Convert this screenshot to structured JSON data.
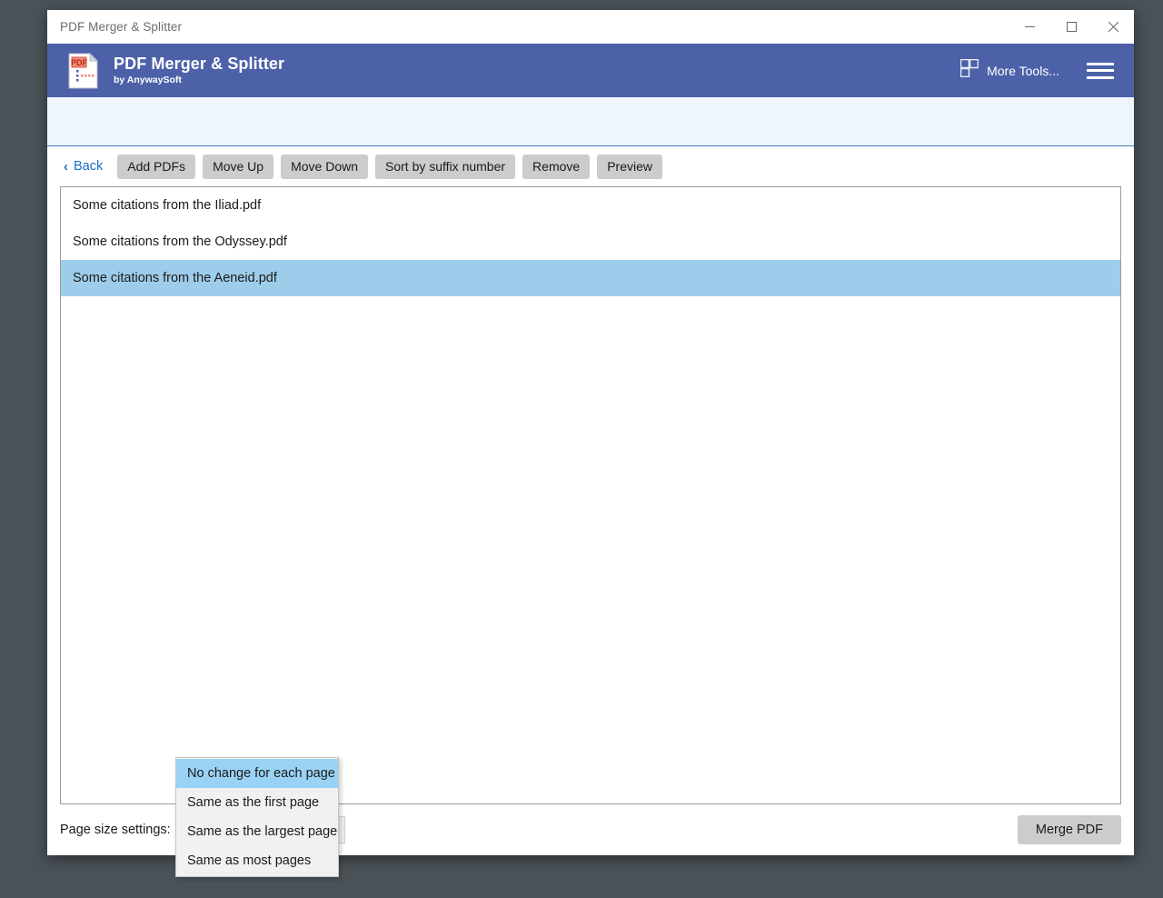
{
  "window": {
    "title": "PDF Merger & Splitter",
    "controls": {
      "minimize": "minimize",
      "maximize": "maximize",
      "close": "close"
    }
  },
  "header": {
    "app_name": "PDF Merger & Splitter",
    "vendor": "by AnywaySoft",
    "more_tools_label": "More Tools...",
    "logo_icon": "pdf-document-icon",
    "grid_icon": "grid-tools-icon",
    "menu_icon": "hamburger-menu-icon",
    "background_color": "#4c61a8"
  },
  "info_band": {
    "text": "",
    "background_color": "#eef5fc",
    "border_color": "#3f7cc4"
  },
  "toolbar": {
    "back_label": "Back",
    "back_chevron": "‹",
    "buttons": [
      {
        "label": "Add PDFs"
      },
      {
        "label": "Move Up"
      },
      {
        "label": "Move Down"
      },
      {
        "label": "Sort by suffix number"
      },
      {
        "label": "Remove"
      },
      {
        "label": "Preview"
      }
    ]
  },
  "file_list": {
    "items": [
      {
        "name": "Some citations from the Iliad.pdf",
        "selected": false
      },
      {
        "name": "Some citations from the Odyssey.pdf",
        "selected": false
      },
      {
        "name": "Some citations from the Aeneid.pdf",
        "selected": true
      }
    ],
    "selection_color": "#9ecdeb"
  },
  "bottom_bar": {
    "page_size_label": "Page size settings:",
    "page_size_value": "Same as the largest page",
    "merge_label": "Merge PDF"
  },
  "page_size_dropdown": {
    "open": true,
    "options": [
      {
        "label": "No change for each page",
        "highlighted": true
      },
      {
        "label": "Same as the first page",
        "highlighted": false
      },
      {
        "label": "Same as the largest page",
        "highlighted": false
      },
      {
        "label": "Same as most pages",
        "highlighted": false
      }
    ],
    "highlight_color": "#9ad2f5"
  }
}
